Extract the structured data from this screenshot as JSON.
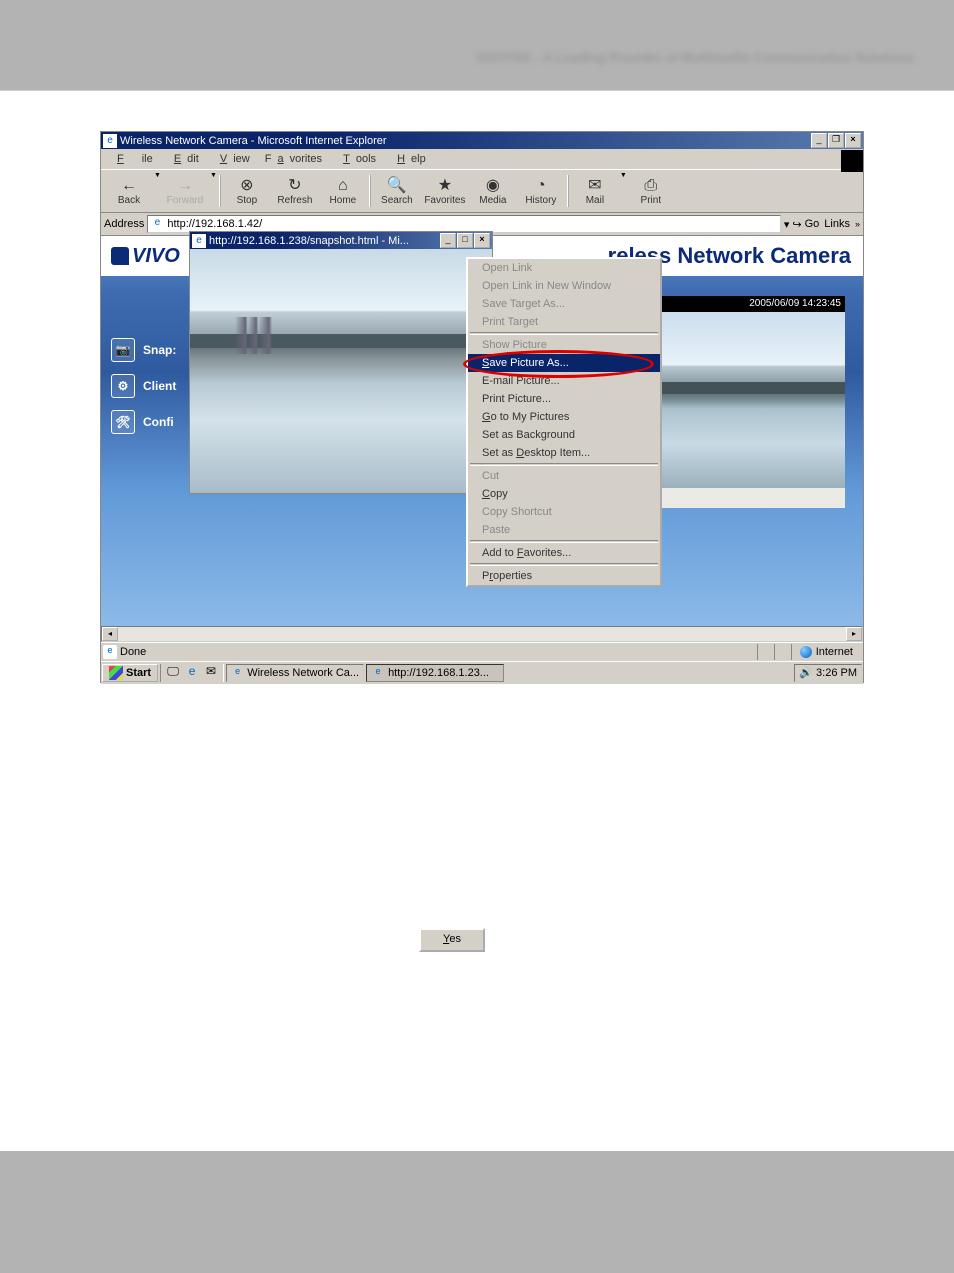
{
  "header_blur": "VIVOTEK - A Leading Provider of Multimedia Communication Solutions",
  "window_title": "Wireless Network Camera - Microsoft Internet Explorer",
  "menu": {
    "file": "File",
    "edit": "Edit",
    "view": "View",
    "fav": "Favorites",
    "tools": "Tools",
    "help": "Help"
  },
  "toolbar": {
    "back": "Back",
    "forward": "Forward",
    "stop": "Stop",
    "refresh": "Refresh",
    "home": "Home",
    "search": "Search",
    "favorites": "Favorites",
    "media": "Media",
    "history": "History",
    "mail": "Mail",
    "print": "Print"
  },
  "addr": {
    "label": "Address",
    "value": "http://192.168.1.42/",
    "go": "Go",
    "links": "Links"
  },
  "logo": "VIVO",
  "pagetitle": "reless Network Camera",
  "sidebar": {
    "snap": "Snap:",
    "client": "Client",
    "conf": "Confi"
  },
  "timestamp": "2005/06/09 14:23:45",
  "popup_title": "http://192.168.1.238/snapshot.html - Mi...",
  "ctx": {
    "ol": "Open Link",
    "olnw": "Open Link in New Window",
    "sta": "Save Target As...",
    "pt": "Print Target",
    "sp": "Show Picture",
    "spa": "Save Picture As...",
    "emp": "E-mail Picture...",
    "pp": "Print Picture...",
    "gtm": "Go to My Pictures",
    "sab": "Set as Background",
    "sad": "Set as Desktop Item...",
    "cut": "Cut",
    "copy": "Copy",
    "cs": "Copy Shortcut",
    "paste": "Paste",
    "atf": "Add to Favorites...",
    "prop": "Properties"
  },
  "status": {
    "done": "Done",
    "internet": "Internet"
  },
  "taskbar": {
    "start": "Start",
    "t1": "Wireless Network Ca...",
    "t2": "http://192.168.1.23...",
    "time": "3:26 PM"
  },
  "yes": "Yes"
}
